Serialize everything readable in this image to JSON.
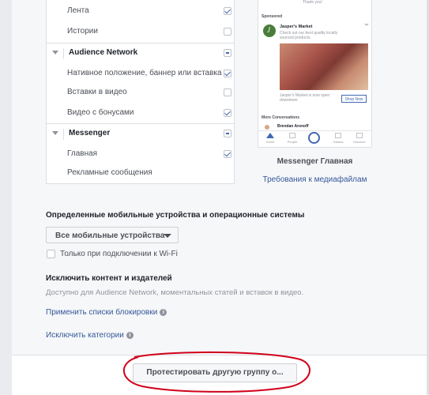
{
  "placements": {
    "facebook_items": [
      {
        "label": "Лента",
        "checked": true
      },
      {
        "label": "Истории",
        "checked": false
      }
    ],
    "audience_network": {
      "title": "Audience Network",
      "items": [
        {
          "label": "Нативное положение, баннер или вставка",
          "checked": true
        },
        {
          "label": "Вставки в видео",
          "checked": false
        },
        {
          "label": "Видео с бонусами",
          "checked": true
        }
      ]
    },
    "messenger": {
      "title": "Messenger",
      "items": [
        {
          "label": "Главная",
          "checked": true
        },
        {
          "label": "Рекламные сообщения",
          "checked": false
        }
      ]
    }
  },
  "preview": {
    "thank_you": "Thank you!",
    "sponsored": "Sponsored",
    "advertiser": "Jasper's Market",
    "ad_text": "Check out our best quality locally sourced products.",
    "caption": "Jasper's Market is now open downtown",
    "cta": "Shop Now",
    "more_conversations": "More Conversations",
    "contact": "Brendan Aronoff",
    "tabs": [
      "Home",
      "People",
      "",
      "Games",
      "Discover"
    ],
    "title": "Messenger Главная",
    "media_link": "Требования к медиафайлам"
  },
  "devices": {
    "title": "Определенные мобильные устройства и операционные системы",
    "dropdown_value": "Все мобильные устройства",
    "wifi_label": "Только при подключении к Wi-Fi"
  },
  "exclusions": {
    "title": "Исключить контент и издателей",
    "description": "Доступно для Audience Network, моментальных статей и вставок в видео.",
    "block_lists_link": "Применить списки блокировки",
    "categories_link": "Исключить категории",
    "info_symbol": "i"
  },
  "footer": {
    "test_button": "Протестировать другую группу о..."
  }
}
